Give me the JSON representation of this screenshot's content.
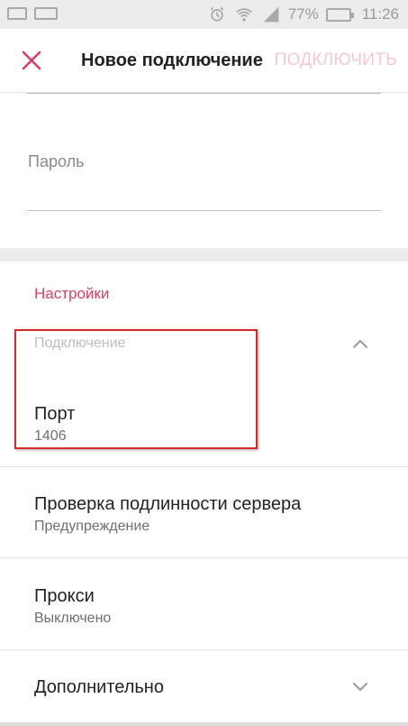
{
  "status_bar": {
    "battery_percent": "77%",
    "time": "11:26",
    "icons": [
      "screenshot-icon",
      "keyboard-icon",
      "alarm-icon",
      "wifi-icon",
      "signal-icon",
      "battery-icon"
    ]
  },
  "app_bar": {
    "title": "Новое подключение",
    "connect_label": "ПОДКЛЮЧИТЬ",
    "close_icon": "close-icon"
  },
  "password": {
    "label": "Пароль",
    "value": ""
  },
  "settings": {
    "header": "Настройки",
    "section_label": "Подключение",
    "rows": [
      {
        "title": "Порт",
        "subtitle": "1406"
      },
      {
        "title": "Проверка подлинности сервера",
        "subtitle": "Предупреждение"
      },
      {
        "title": "Прокси",
        "subtitle": "Выключено"
      },
      {
        "title": "Дополнительно",
        "subtitle": ""
      }
    ]
  },
  "colors": {
    "accent": "#d84060",
    "connect_disabled": "#f6c8cf",
    "highlight": "#d62a2a",
    "background": "#ececec"
  }
}
